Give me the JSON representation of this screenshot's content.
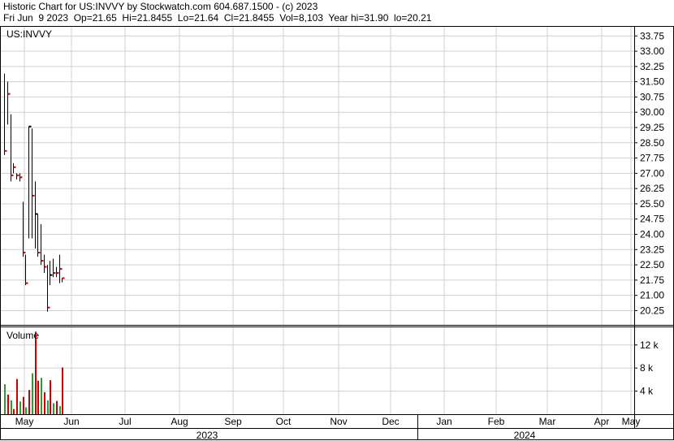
{
  "header": {
    "line1": "Historic Chart for US:INVVY by Stockwatch.com 604.687.1500 - (c) 2023",
    "line2": "Fri Jun  9 2023  Op=21.65  Hi=21.8455  Lo=21.64  Cl=21.8455  Vol=8,103  Year hi=31.90  lo=20.21"
  },
  "price_panel": {
    "label": "US:INVVY"
  },
  "volume_panel": {
    "label": "Volume"
  },
  "colors": {
    "up": "#000000",
    "down": "#cc0000",
    "grid": "#d0d0d0",
    "frame": "#000000"
  },
  "chart_data": [
    {
      "type": "bar",
      "subtype": "ohlc",
      "x_axis": {
        "month_labels": [
          "May",
          "Jun",
          "Jul",
          "Aug",
          "Sep",
          "Oct",
          "Nov",
          "Dec",
          "Jan",
          "Feb",
          "Mar",
          "Apr",
          "May"
        ],
        "year_labels": [
          "2023",
          "2024"
        ]
      },
      "y_axis": {
        "ticks": [
          "20.25",
          "21.00",
          "21.75",
          "22.50",
          "23.25",
          "24.00",
          "24.75",
          "25.50",
          "26.25",
          "27.00",
          "27.75",
          "28.50",
          "29.25",
          "30.00",
          "30.75",
          "31.50",
          "32.25",
          "33.00",
          "33.75"
        ],
        "range": [
          19.55,
          34.2
        ]
      },
      "grid": true,
      "bars": [
        {
          "high": 31.9,
          "low": 27.9,
          "close": 28.1,
          "color": "down"
        },
        {
          "high": 31.5,
          "low": 29.4,
          "close": 30.9,
          "color": "down"
        },
        {
          "high": 29.9,
          "low": 26.6,
          "close": 26.9,
          "color": "down"
        },
        {
          "high": 27.5,
          "low": 27.0,
          "close": 27.3,
          "color": "down"
        },
        {
          "high": 27.0,
          "low": 26.7,
          "close": 26.9,
          "color": "down"
        },
        {
          "high": 27.0,
          "low": 26.6,
          "close": 26.8,
          "color": "down"
        },
        {
          "high": 25.6,
          "low": 22.9,
          "close": 23.1,
          "color": "down"
        },
        {
          "high": 23.0,
          "low": 21.5,
          "close": 21.6,
          "color": "down"
        },
        {
          "high": 29.3,
          "low": 23.8,
          "close": 29.3,
          "color": "up"
        },
        {
          "high": 29.2,
          "low": 23.8,
          "close": 25.9,
          "color": "down"
        },
        {
          "high": 26.6,
          "low": 23.3,
          "close": 25.0,
          "color": "up"
        },
        {
          "high": 25.0,
          "low": 22.9,
          "close": 23.1,
          "color": "down"
        },
        {
          "high": 24.5,
          "low": 22.5,
          "close": 22.7,
          "color": "down"
        },
        {
          "high": 23.0,
          "low": 22.1,
          "close": 22.4,
          "color": "down"
        },
        {
          "high": 22.5,
          "low": 20.2,
          "close": 20.4,
          "color": "down"
        },
        {
          "high": 22.7,
          "low": 21.5,
          "close": 22.0,
          "color": "up"
        },
        {
          "high": 22.8,
          "low": 21.9,
          "close": 22.1,
          "color": "down"
        },
        {
          "high": 22.4,
          "low": 21.9,
          "close": 22.1,
          "color": "down"
        },
        {
          "high": 23.0,
          "low": 21.6,
          "close": 22.3,
          "color": "down"
        },
        {
          "high": 21.85,
          "low": 21.64,
          "close": 21.8455,
          "color": "down"
        }
      ]
    },
    {
      "type": "bar",
      "subtype": "volume",
      "label": "Volume",
      "y_axis": {
        "ticks": [
          "4 k",
          "8 k",
          "12 k"
        ],
        "range": [
          0,
          14500
        ]
      },
      "grid": true,
      "values": [
        5200,
        3400,
        2400,
        900,
        6100,
        2200,
        3000,
        1200,
        4200,
        7100,
        14300,
        5800,
        6300,
        3800,
        2400,
        5900,
        1900,
        2300,
        1400,
        8103
      ],
      "colors": [
        "up",
        "down",
        "up",
        "down",
        "down",
        "up",
        "down",
        "up",
        "down",
        "up",
        "down",
        "down",
        "up",
        "down",
        "up",
        "down",
        "up",
        "down",
        "up",
        "down"
      ]
    }
  ]
}
